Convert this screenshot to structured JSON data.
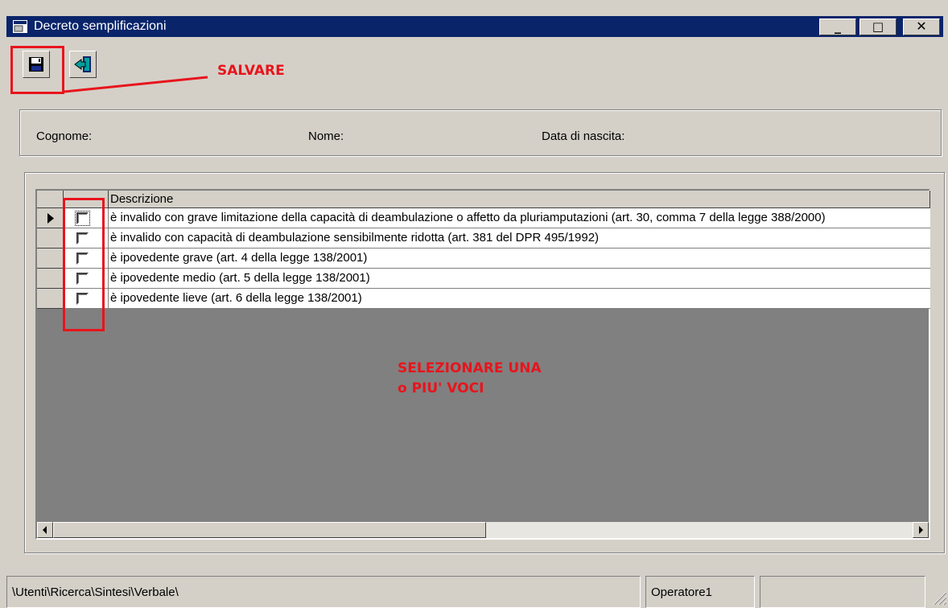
{
  "window": {
    "title": "Decreto semplificazioni",
    "minimize_glyph": "_",
    "maximize_glyph": "□",
    "close_glyph": "✕"
  },
  "toolbar": {
    "save_icon": "floppy-disk-icon",
    "exit_icon": "exit-door-icon"
  },
  "annotations": {
    "save_note": "SALVARE",
    "select_note_line1": "SELEZIONARE UNA",
    "select_note_line2": "o PIU' VOCI",
    "color": "#e8141c"
  },
  "person": {
    "cognome_label": "Cognome:",
    "nome_label": "Nome:",
    "data_nascita_label": "Data di nascita:"
  },
  "grid": {
    "header_descrizione": "Descrizione",
    "rows": [
      {
        "checked": false,
        "current": true,
        "descrizione": "è invalido con grave limitazione della capacità di deambulazione o affetto da pluriamputazioni (art. 30, comma 7 della legge 388/2000)"
      },
      {
        "checked": false,
        "current": false,
        "descrizione": "è invalido con capacità di deambulazione sensibilmente ridotta (art. 381 del DPR 495/1992)"
      },
      {
        "checked": false,
        "current": false,
        "descrizione": "è ipovedente grave (art. 4 della legge 138/2001)"
      },
      {
        "checked": false,
        "current": false,
        "descrizione": "è ipovedente medio (art. 5 della legge 138/2001)"
      },
      {
        "checked": false,
        "current": false,
        "descrizione": "è ipovedente lieve (art. 6 della legge 138/2001)"
      }
    ]
  },
  "statusbar": {
    "path": "\\Utenti\\Ricerca\\Sintesi\\Verbale\\",
    "operator": "Operatore1",
    "empty_panel": ""
  }
}
